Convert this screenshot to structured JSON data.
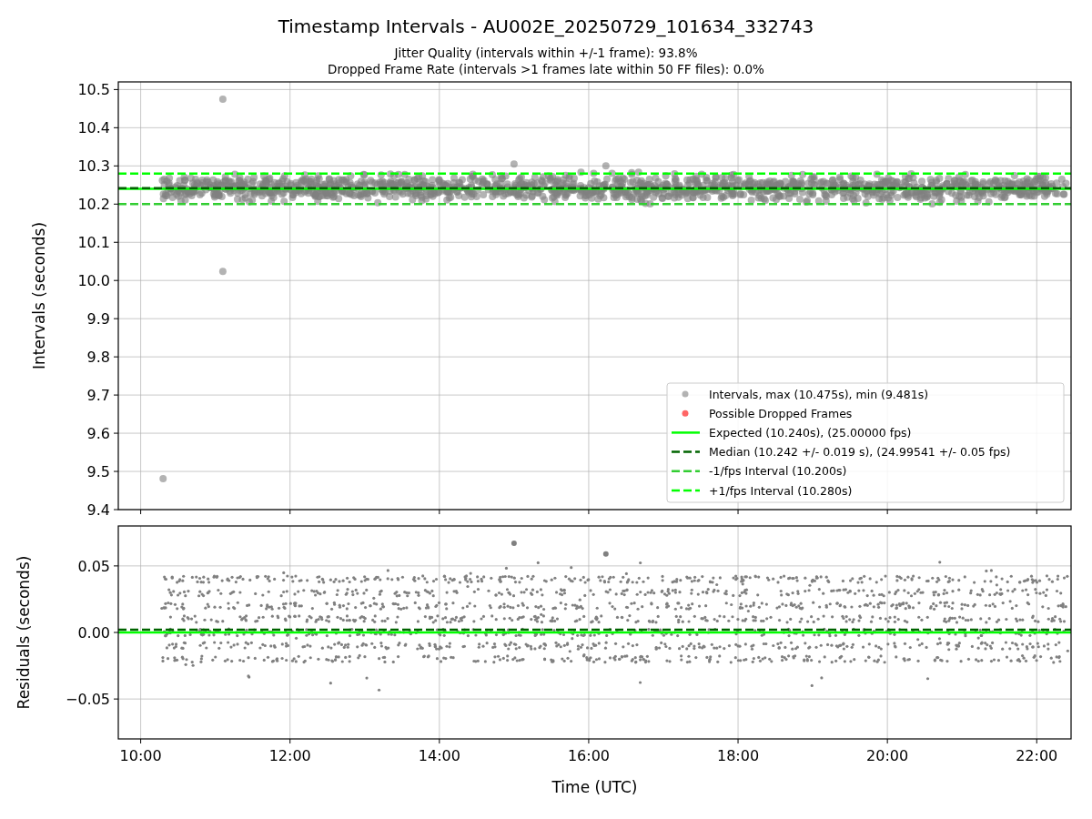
{
  "figure": {
    "title": "Timestamp Intervals - AU002E_20250729_101634_332743",
    "subtitles": [
      "Jitter Quality (intervals within +/-1 frame): 93.8%",
      "Dropped Frame Rate (intervals >1 frames late within 50 FF files): 0.0%"
    ]
  },
  "intervals_plot": {
    "chart_data": {
      "type": "scatter",
      "ylabel": "Intervals (seconds)",
      "grid": true,
      "legend": true,
      "xlim": [
        9.7,
        22.46
      ],
      "ylim": [
        9.4,
        10.52
      ],
      "yticks": [
        {
          "value": 9.4,
          "label": "9.4"
        },
        {
          "value": 9.5,
          "label": "9.5"
        },
        {
          "value": 9.6,
          "label": "9.6"
        },
        {
          "value": 9.7,
          "label": "9.7"
        },
        {
          "value": 9.8,
          "label": "9.8"
        },
        {
          "value": 9.9,
          "label": "9.9"
        },
        {
          "value": 10.0,
          "label": "10.0"
        },
        {
          "value": 10.1,
          "label": "10.1"
        },
        {
          "value": 10.2,
          "label": "10.2"
        },
        {
          "value": 10.3,
          "label": "10.3"
        },
        {
          "value": 10.4,
          "label": "10.4"
        },
        {
          "value": 10.5,
          "label": "10.5"
        }
      ],
      "series": [
        {
          "name": "Intervals, max (10.475s), min (9.481s)",
          "color": "#808080",
          "x": [
            10.3,
            11.1,
            11.1,
            15.0,
            16.23
          ],
          "values": [
            9.481,
            10.475,
            10.024,
            10.305,
            10.3
          ]
        },
        {
          "name": "Possible Dropped Frames",
          "color": "#ff0000"
        },
        {
          "name": "Expected (10.240s), (25.00000 fps)",
          "type": "line",
          "line_style": "solid",
          "color": "#00ff00",
          "x": [
            9.7,
            22.46
          ],
          "values": [
            10.24,
            10.24
          ]
        },
        {
          "name": "Median (10.242 +/- 0.019 s), (24.99541 +/- 0.05 fps)",
          "type": "line",
          "line_style": "dashed",
          "color": "#006400",
          "x": [
            9.7,
            22.46
          ],
          "values": [
            10.242,
            10.242
          ]
        },
        {
          "name": "-1/fps Interval (10.200s)",
          "type": "line",
          "line_style": "dashed",
          "color": "#32cd32",
          "x": [
            9.7,
            22.46
          ],
          "values": [
            10.2,
            10.2
          ]
        },
        {
          "name": "+1/fps Interval (10.280s)",
          "type": "line",
          "line_style": "dashed",
          "color": "#00ff00",
          "x": [
            9.7,
            22.46
          ],
          "values": [
            10.28,
            10.28
          ]
        }
      ]
    }
  },
  "residuals_plot": {
    "chart_data": {
      "type": "scatter",
      "xlabel": "Time (UTC)",
      "ylabel": "Residuals (seconds)",
      "grid": true,
      "xlim": [
        9.7,
        22.46
      ],
      "ylim": [
        -0.08,
        0.08
      ],
      "xticks": [
        {
          "value": 10,
          "label": "10:00"
        },
        {
          "value": 12,
          "label": "12:00"
        },
        {
          "value": 14,
          "label": "14:00"
        },
        {
          "value": 16,
          "label": "16:00"
        },
        {
          "value": 18,
          "label": "18:00"
        },
        {
          "value": 20,
          "label": "20:00"
        },
        {
          "value": 22,
          "label": "22:00"
        }
      ],
      "yticks": [
        {
          "value": -0.05,
          "label": "−0.05"
        },
        {
          "value": 0,
          "label": "0.00"
        },
        {
          "value": 0.05,
          "label": "0.05"
        }
      ],
      "series": [
        {
          "color": "#808080",
          "x": [
            15.0,
            16.23
          ],
          "values": [
            0.067,
            0.059
          ]
        },
        {
          "type": "line",
          "line_style": "solid",
          "color": "#00ff00",
          "x": [
            9.7,
            22.46
          ],
          "values": [
            0,
            0
          ]
        },
        {
          "type": "line",
          "line_style": "dashed",
          "color": "#006400",
          "x": [
            9.7,
            22.46
          ],
          "values": [
            0.002,
            0.002
          ]
        }
      ]
    }
  }
}
